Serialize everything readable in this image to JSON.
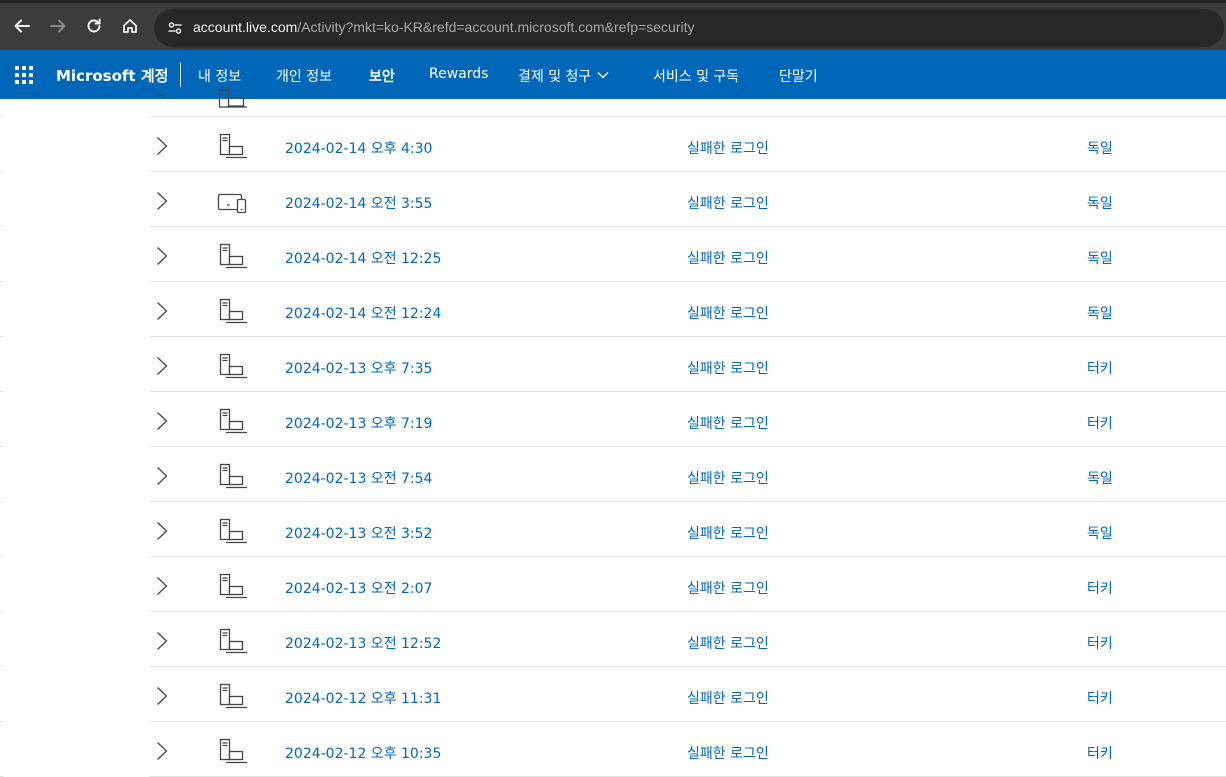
{
  "browser": {
    "url_host": "account.live.com",
    "url_rest": "/Activity?mkt=ko-KR&refd=account.microsoft.com&refp=security"
  },
  "header": {
    "brand": "Microsoft 계정",
    "nav": [
      {
        "label": "내 정보"
      },
      {
        "label": "개인 정보"
      },
      {
        "label": "보안"
      },
      {
        "label": "Rewards"
      },
      {
        "label": "결제 및 청구"
      },
      {
        "label": "서비스 및 구독"
      },
      {
        "label": "단말기"
      }
    ]
  },
  "activity": [
    {
      "date": "2024-02-14 오후 4:30",
      "type": "실패한 로그인",
      "country": "독일",
      "device_icon": "desktop-laptop-icon"
    },
    {
      "date": "2024-02-14 오전 3:55",
      "type": "실패한 로그인",
      "country": "독일",
      "device_icon": "tablet-phone-icon"
    },
    {
      "date": "2024-02-14 오전 12:25",
      "type": "실패한 로그인",
      "country": "독일",
      "device_icon": "desktop-laptop-icon"
    },
    {
      "date": "2024-02-14 오전 12:24",
      "type": "실패한 로그인",
      "country": "독일",
      "device_icon": "desktop-laptop-icon"
    },
    {
      "date": "2024-02-13 오후 7:35",
      "type": "실패한 로그인",
      "country": "터키",
      "device_icon": "desktop-laptop-icon"
    },
    {
      "date": "2024-02-13 오후 7:19",
      "type": "실패한 로그인",
      "country": "터키",
      "device_icon": "desktop-laptop-icon"
    },
    {
      "date": "2024-02-13 오전 7:54",
      "type": "실패한 로그인",
      "country": "독일",
      "device_icon": "desktop-laptop-icon"
    },
    {
      "date": "2024-02-13 오전 3:52",
      "type": "실패한 로그인",
      "country": "독일",
      "device_icon": "desktop-laptop-icon"
    },
    {
      "date": "2024-02-13 오전 2:07",
      "type": "실패한 로그인",
      "country": "터키",
      "device_icon": "desktop-laptop-icon"
    },
    {
      "date": "2024-02-13 오전 12:52",
      "type": "실패한 로그인",
      "country": "터키",
      "device_icon": "desktop-laptop-icon"
    },
    {
      "date": "2024-02-12 오후 11:31",
      "type": "실패한 로그인",
      "country": "터키",
      "device_icon": "desktop-laptop-icon"
    },
    {
      "date": "2024-02-12 오후 10:35",
      "type": "실패한 로그인",
      "country": "터키",
      "device_icon": "desktop-laptop-icon"
    }
  ],
  "colors": {
    "header_bg": "#0067b8",
    "link": "#0067b8",
    "chrome_bg": "#3c3c3c",
    "omnibox_bg": "#282828"
  }
}
